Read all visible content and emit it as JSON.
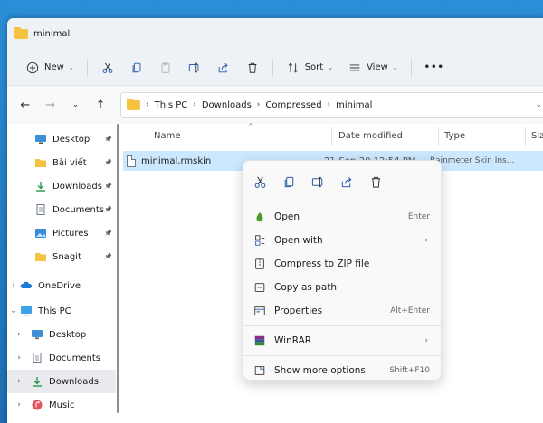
{
  "window": {
    "title": "minimal"
  },
  "toolbar": {
    "new_label": "New",
    "sort_label": "Sort",
    "view_label": "View",
    "more_label": "•••"
  },
  "address": {
    "crumbs": [
      "This PC",
      "Downloads",
      "Compressed",
      "minimal"
    ]
  },
  "sidebar": {
    "items": [
      {
        "label": "Desktop",
        "icon": "desktop-icon",
        "pinned": true
      },
      {
        "label": "Bài viết",
        "icon": "folder-icon",
        "pinned": true
      },
      {
        "label": "Downloads",
        "icon": "download-icon",
        "pinned": true
      },
      {
        "label": "Documents",
        "icon": "documents-icon",
        "pinned": true
      },
      {
        "label": "Pictures",
        "icon": "pictures-icon",
        "pinned": true
      },
      {
        "label": "Snagit",
        "icon": "folder-icon",
        "pinned": true
      },
      {
        "label": "OneDrive",
        "icon": "cloud-icon",
        "chev": "›"
      },
      {
        "label": "This PC",
        "icon": "pc-icon",
        "chev": "⌄"
      },
      {
        "label": "Desktop",
        "icon": "desktop-icon",
        "chev": "›"
      },
      {
        "label": "Documents",
        "icon": "documents-icon",
        "chev": "›"
      },
      {
        "label": "Downloads",
        "icon": "download-icon",
        "chev": "›",
        "selected": true
      },
      {
        "label": "Music",
        "icon": "music-icon",
        "chev": "›"
      }
    ],
    "pin_glyph": "📌"
  },
  "columns": {
    "name": "Name",
    "date": "Date modified",
    "type": "Type",
    "size": "Size"
  },
  "file": {
    "name": "minimal.rmskin",
    "date": "21-Sep-20 12:54 PM",
    "type": "Rainmeter Skin Ins..."
  },
  "context_menu": {
    "items": [
      {
        "label": "Open",
        "shortcut": "Enter",
        "icon": "rainmeter-icon"
      },
      {
        "label": "Open with",
        "arrow": "›",
        "icon": "open-with-icon"
      },
      {
        "label": "Compress to ZIP file",
        "icon": "zip-icon"
      },
      {
        "label": "Copy as path",
        "icon": "copy-path-icon"
      },
      {
        "label": "Properties",
        "shortcut": "Alt+Enter",
        "icon": "properties-icon"
      },
      {
        "label": "WinRAR",
        "arrow": "›",
        "icon": "winrar-icon"
      },
      {
        "label": "Show more options",
        "shortcut": "Shift+F10",
        "icon": "more-options-icon"
      }
    ]
  },
  "colors": {
    "accent": "#0067c0",
    "selection": "#cce8ff",
    "folder": "#f5c242"
  }
}
